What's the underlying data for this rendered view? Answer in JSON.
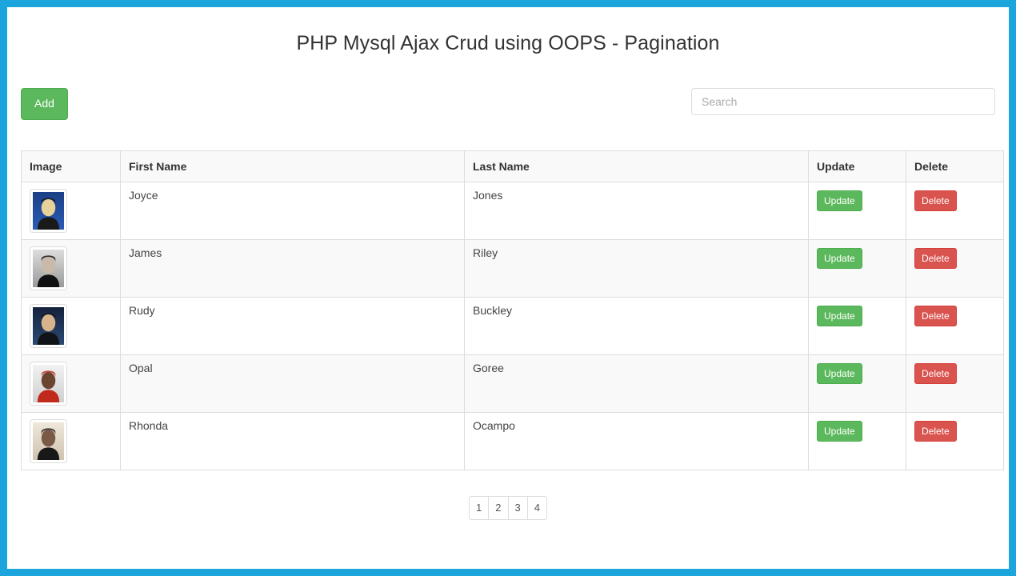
{
  "page": {
    "title": "PHP Mysql Ajax Crud using OOPS - Pagination",
    "border_color": "#1ca5dd"
  },
  "toolbar": {
    "add_label": "Add",
    "add_color": "#5cb85c",
    "search_placeholder": "Search",
    "search_value": ""
  },
  "table": {
    "headers": [
      "Image",
      "First Name",
      "Last Name",
      "Update",
      "Delete"
    ],
    "rows": [
      {
        "image_alt": "portrait-joyce",
        "first_name": "Joyce",
        "last_name": "Jones",
        "update_label": "Update",
        "delete_label": "Delete"
      },
      {
        "image_alt": "portrait-james",
        "first_name": "James",
        "last_name": "Riley",
        "update_label": "Update",
        "delete_label": "Delete"
      },
      {
        "image_alt": "portrait-rudy",
        "first_name": "Rudy",
        "last_name": "Buckley",
        "update_label": "Update",
        "delete_label": "Delete"
      },
      {
        "image_alt": "portrait-opal",
        "first_name": "Opal",
        "last_name": "Goree",
        "update_label": "Update",
        "delete_label": "Delete"
      },
      {
        "image_alt": "portrait-rhonda",
        "first_name": "Rhonda",
        "last_name": "Ocampo",
        "update_label": "Update",
        "delete_label": "Delete"
      }
    ],
    "update_color": "#5cb85c",
    "delete_color": "#d9534f"
  },
  "pagination": {
    "pages": [
      "1",
      "2",
      "3",
      "4"
    ],
    "active": "1"
  }
}
